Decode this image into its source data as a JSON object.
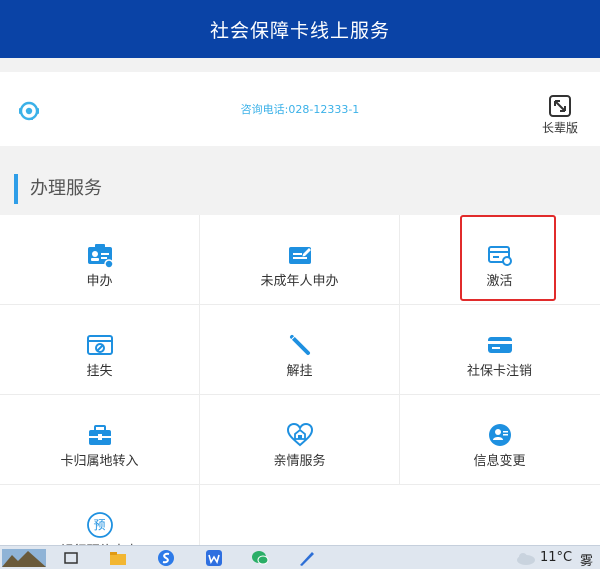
{
  "header": {
    "title": "社会保障卡线上服务"
  },
  "contact": {
    "phone": "咨询电话:028-12333-1",
    "elder_label": "长辈版"
  },
  "section": {
    "title": "办理服务"
  },
  "services": [
    {
      "label": "申办",
      "icon": "id-card-icon"
    },
    {
      "label": "未成年人申办",
      "icon": "edit-card-icon"
    },
    {
      "label": "激活",
      "icon": "card-activate-icon"
    },
    {
      "label": "挂失",
      "icon": "card-lost-icon"
    },
    {
      "label": "解挂",
      "icon": "unlink-icon"
    },
    {
      "label": "社保卡注销",
      "icon": "card-cancel-icon"
    },
    {
      "label": "卡归属地转入",
      "icon": "transfer-icon"
    },
    {
      "label": "亲情服务",
      "icon": "family-heart-icon"
    },
    {
      "label": "信息变更",
      "icon": "info-change-icon"
    },
    {
      "label": "银行预约申卡",
      "icon": "reserve-icon"
    }
  ],
  "reserve_badge": "预",
  "taskbar": {
    "temperature": "11°C",
    "weather": "雾"
  },
  "colors": {
    "header": "#0a43a6",
    "accent": "#2f9ee8",
    "icon": "#1e90e0",
    "highlight": "#e12b2b"
  }
}
